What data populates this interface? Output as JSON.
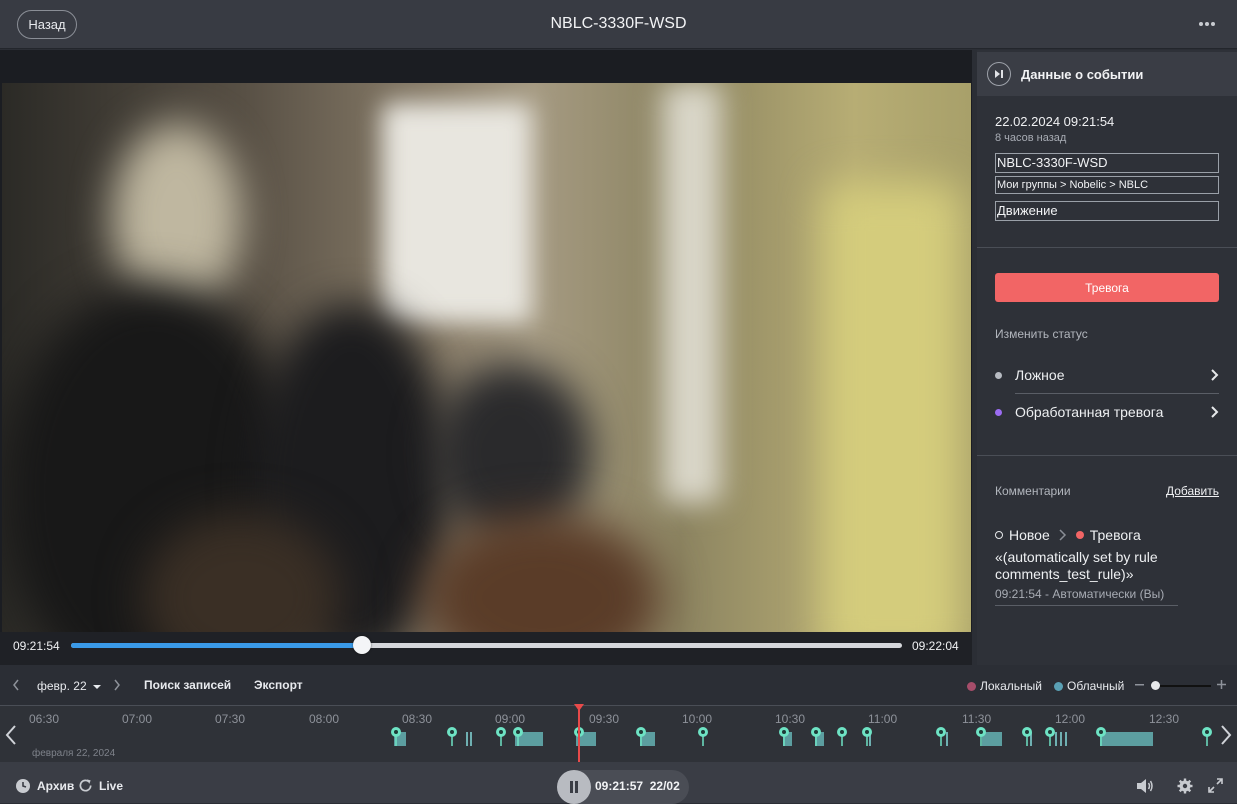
{
  "header": {
    "back_label": "Назад",
    "title": "NBLC-3330F-WSD"
  },
  "player": {
    "time_start": "09:21:54",
    "time_end": "09:22:04",
    "progress": 0.35
  },
  "event_panel": {
    "title": "Данные о событии",
    "datetime": "22.02.2024 09:21:54",
    "ago": "8 часов назад",
    "camera": "NBLC-3330F-WSD",
    "group_path": "Мои группы > Nobelic > NBLC",
    "event_type": "Движение",
    "alarm_label": "Тревога",
    "change_status_label": "Изменить статус",
    "statuses": [
      {
        "label": "Ложное",
        "color": "#b7bbc2"
      },
      {
        "label": "Обработанная тревога",
        "color": "#9b6cf2"
      }
    ],
    "comments_label": "Комментарии",
    "add_label": "Добавить",
    "comment": {
      "from": "Новое",
      "to": "Тревога",
      "text": "«(automatically set by rule comments_test_rule)»",
      "meta": "09:21:54 - Автоматически (Вы)"
    }
  },
  "timeline_toolbar": {
    "date": "февр. 22",
    "search_label": "Поиск записей",
    "export_label": "Экспорт",
    "legend_local": "Локальный",
    "legend_cloud": "Облачный",
    "local_color": "#a64d6a",
    "cloud_color": "#5aa0b4"
  },
  "timeline": {
    "ticks": [
      "06:30",
      "07:00",
      "07:30",
      "08:00",
      "08:30",
      "09:00",
      "09:30",
      "10:00",
      "10:30",
      "11:00",
      "11:30",
      "12:00",
      "12:30"
    ],
    "date_label": "февраля 22, 2024"
  },
  "bottom": {
    "archive_label": "Архив",
    "live_label": "Live",
    "play_time": "09:21:57",
    "play_date": "22/02"
  }
}
